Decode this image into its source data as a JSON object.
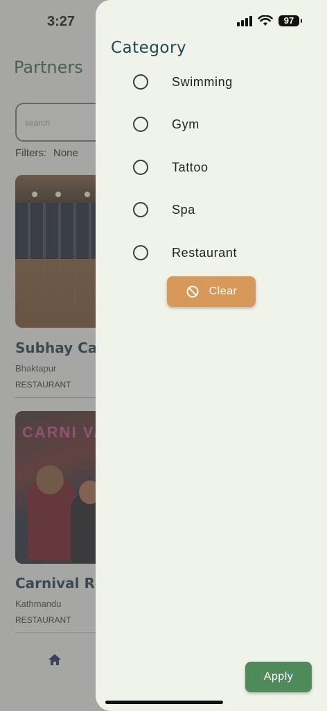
{
  "status_bar": {
    "time": "3:27",
    "battery": "97"
  },
  "background": {
    "title": "Partners",
    "search_placeholder": "search",
    "filters_label": "Filters:",
    "filters_value": "None",
    "cards": [
      {
        "name": "Subhay Cafe",
        "location": "Bhaktapur",
        "category": "RESTAURANT"
      },
      {
        "name": "Carnival Res",
        "location": "Kathmandu",
        "category": "RESTAURANT"
      }
    ],
    "image_sign_text": "CARNI VAL"
  },
  "drawer": {
    "title": "Category",
    "options": [
      {
        "label": "Swimming",
        "selected": false
      },
      {
        "label": "Gym",
        "selected": false
      },
      {
        "label": "Tattoo",
        "selected": false
      },
      {
        "label": "Spa",
        "selected": false
      },
      {
        "label": "Restaurant",
        "selected": false
      }
    ],
    "clear_label": "Clear",
    "apply_label": "Apply",
    "colors": {
      "clear": "#d7995a",
      "apply": "#4f8a5a",
      "title": "#1e4a55"
    }
  }
}
